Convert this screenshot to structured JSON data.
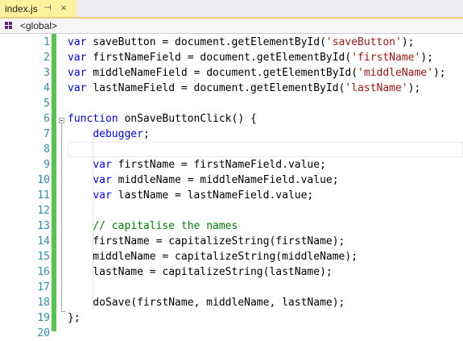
{
  "tab": {
    "title": "index.js",
    "pin_glyph": "⊣",
    "close_glyph": "×"
  },
  "navbar": {
    "scope": "<global>",
    "icon": "namespace-icon"
  },
  "colors": {
    "keyword": "#0000ff",
    "string": "#a31515",
    "comment": "#008000",
    "line_number": "#2b91af",
    "change_bar": "#57c450",
    "tab_active": "#fff29d"
  },
  "editor": {
    "current_line": 8,
    "lines": [
      {
        "n": "1",
        "tokens": [
          {
            "t": "kw",
            "v": "var"
          },
          {
            "t": "pl",
            "v": " saveButton = document.getElementById("
          },
          {
            "t": "str",
            "v": "'saveButton'"
          },
          {
            "t": "pl",
            "v": ");"
          }
        ]
      },
      {
        "n": "2",
        "tokens": [
          {
            "t": "kw",
            "v": "var"
          },
          {
            "t": "pl",
            "v": " firstNameField = document.getElementById("
          },
          {
            "t": "str",
            "v": "'firstName'"
          },
          {
            "t": "pl",
            "v": ");"
          }
        ]
      },
      {
        "n": "3",
        "tokens": [
          {
            "t": "kw",
            "v": "var"
          },
          {
            "t": "pl",
            "v": " middleNameField = document.getElementById("
          },
          {
            "t": "str",
            "v": "'middleName'"
          },
          {
            "t": "pl",
            "v": ");"
          }
        ]
      },
      {
        "n": "4",
        "tokens": [
          {
            "t": "kw",
            "v": "var"
          },
          {
            "t": "pl",
            "v": " lastNameField = document.getElementById("
          },
          {
            "t": "str",
            "v": "'lastName'"
          },
          {
            "t": "pl",
            "v": ");"
          }
        ]
      },
      {
        "n": "5",
        "tokens": []
      },
      {
        "n": "6",
        "tokens": [
          {
            "t": "kw",
            "v": "function"
          },
          {
            "t": "pl",
            "v": " onSaveButtonClick() {"
          }
        ]
      },
      {
        "n": "7",
        "tokens": [
          {
            "t": "pl",
            "v": "    "
          },
          {
            "t": "kw",
            "v": "debugger"
          },
          {
            "t": "pl",
            "v": ";"
          }
        ]
      },
      {
        "n": "8",
        "tokens": []
      },
      {
        "n": "9",
        "tokens": [
          {
            "t": "pl",
            "v": "    "
          },
          {
            "t": "kw",
            "v": "var"
          },
          {
            "t": "pl",
            "v": " firstName = firstNameField.value;"
          }
        ]
      },
      {
        "n": "10",
        "tokens": [
          {
            "t": "pl",
            "v": "    "
          },
          {
            "t": "kw",
            "v": "var"
          },
          {
            "t": "pl",
            "v": " middleName = middleNameField.value;"
          }
        ]
      },
      {
        "n": "11",
        "tokens": [
          {
            "t": "pl",
            "v": "    "
          },
          {
            "t": "kw",
            "v": "var"
          },
          {
            "t": "pl",
            "v": " lastName = lastNameField.value;"
          }
        ]
      },
      {
        "n": "12",
        "tokens": []
      },
      {
        "n": "13",
        "tokens": [
          {
            "t": "pl",
            "v": "    "
          },
          {
            "t": "cmt",
            "v": "// capitalise the names"
          }
        ]
      },
      {
        "n": "14",
        "tokens": [
          {
            "t": "pl",
            "v": "    firstName = capitalizeString(firstName);"
          }
        ]
      },
      {
        "n": "15",
        "tokens": [
          {
            "t": "pl",
            "v": "    middleName = capitalizeString(middleName);"
          }
        ]
      },
      {
        "n": "16",
        "tokens": [
          {
            "t": "pl",
            "v": "    lastName = capitalizeString(lastName);"
          }
        ]
      },
      {
        "n": "17",
        "tokens": []
      },
      {
        "n": "18",
        "tokens": [
          {
            "t": "pl",
            "v": "    doSave(firstName, middleName, lastName);"
          }
        ]
      },
      {
        "n": "19",
        "tokens": [
          {
            "t": "pl",
            "v": "};"
          }
        ]
      },
      {
        "n": "20",
        "tokens": []
      }
    ]
  }
}
